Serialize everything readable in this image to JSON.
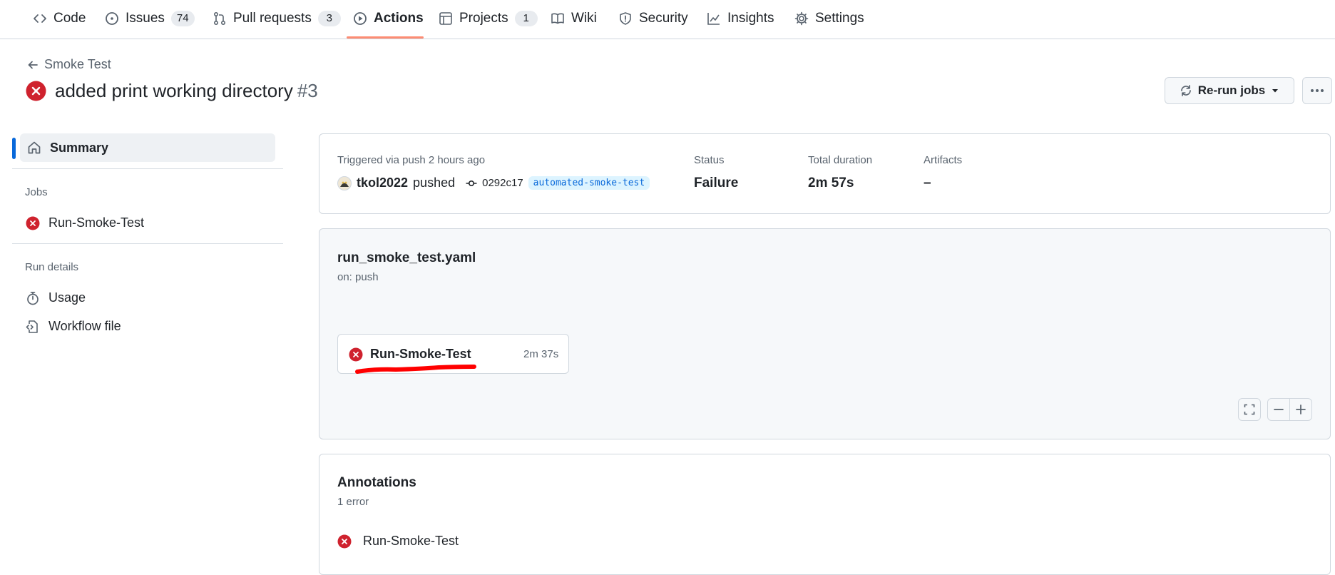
{
  "nav": {
    "tabs": [
      {
        "label": "Code",
        "icon": "code-icon"
      },
      {
        "label": "Issues",
        "count": "74",
        "icon": "issue-icon"
      },
      {
        "label": "Pull requests",
        "count": "3",
        "icon": "pull-request-icon"
      },
      {
        "label": "Actions",
        "icon": "play-icon",
        "active": true
      },
      {
        "label": "Projects",
        "count": "1",
        "icon": "table-icon"
      },
      {
        "label": "Wiki",
        "icon": "book-icon"
      },
      {
        "label": "Security",
        "icon": "shield-icon"
      },
      {
        "label": "Insights",
        "icon": "graph-icon"
      },
      {
        "label": "Settings",
        "icon": "gear-icon"
      }
    ]
  },
  "header": {
    "back_label": "Smoke Test",
    "title": "added print working directory",
    "run_number": "#3",
    "rerun_label": "Re-run jobs"
  },
  "sidebar": {
    "summary_label": "Summary",
    "jobs_heading": "Jobs",
    "jobs": [
      {
        "label": "Run-Smoke-Test",
        "status": "failure"
      }
    ],
    "run_details_heading": "Run details",
    "details": [
      {
        "label": "Usage",
        "icon": "stopwatch-icon"
      },
      {
        "label": "Workflow file",
        "icon": "file-code-icon"
      }
    ]
  },
  "summary": {
    "trigger": "Triggered via push 2 hours ago",
    "actor": "tkol2022",
    "action": "pushed",
    "commit": "0292c17",
    "branch": "automated-smoke-test",
    "status_label": "Status",
    "status_value": "Failure",
    "duration_label": "Total duration",
    "duration_value": "2m 57s",
    "artifacts_label": "Artifacts",
    "artifacts_value": "–"
  },
  "workflow": {
    "file": "run_smoke_test.yaml",
    "trigger": "on: push",
    "job": {
      "name": "Run-Smoke-Test",
      "duration": "2m 37s",
      "status": "failure"
    }
  },
  "annotations": {
    "title": "Annotations",
    "count": "1 error",
    "items": [
      {
        "title": "Run-Smoke-Test",
        "status": "failure"
      }
    ]
  },
  "colors": {
    "failure": "#cf222e",
    "accent": "#0969da",
    "tab_underline": "#fd8c73",
    "highlight_stroke": "#ff0000"
  }
}
